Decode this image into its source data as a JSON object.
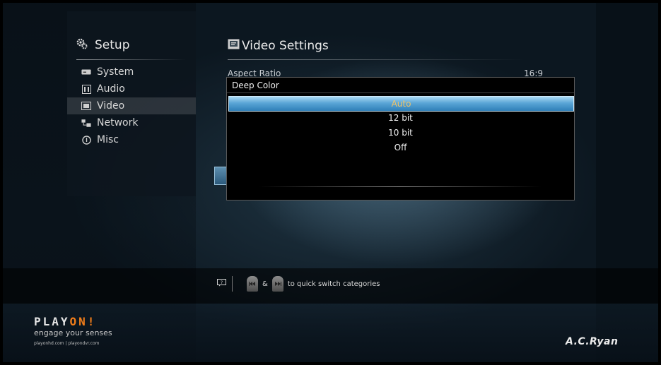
{
  "sidebar": {
    "title": "Setup",
    "items": [
      {
        "label": "System",
        "icon": "system-icon"
      },
      {
        "label": "Audio",
        "icon": "audio-icon"
      },
      {
        "label": "Video",
        "icon": "video-icon",
        "active": true
      },
      {
        "label": "Network",
        "icon": "network-icon"
      },
      {
        "label": "Misc",
        "icon": "misc-icon"
      }
    ]
  },
  "content": {
    "title": "Video Settings",
    "setting": {
      "label": "Aspect Ratio",
      "value": "16:9"
    }
  },
  "dialog": {
    "title": "Deep Color",
    "options": [
      "Auto",
      "12 bit",
      "10 bit",
      "Off"
    ],
    "selected": "Auto"
  },
  "hint": {
    "amp": "&",
    "text": "to quick switch categories"
  },
  "footer": {
    "brand_logo": "PLAYON!",
    "brand_logo_main": "PLAY",
    "brand_logo_accent": "ON!",
    "tagline": "engage your senses",
    "urls": "playonhd.com | playondvr.com",
    "maker": "A.C.Ryan"
  },
  "colors": {
    "selection": "#5aa5d6",
    "selected_text": "#f0c46a",
    "logo_accent": "#f07d1a"
  }
}
